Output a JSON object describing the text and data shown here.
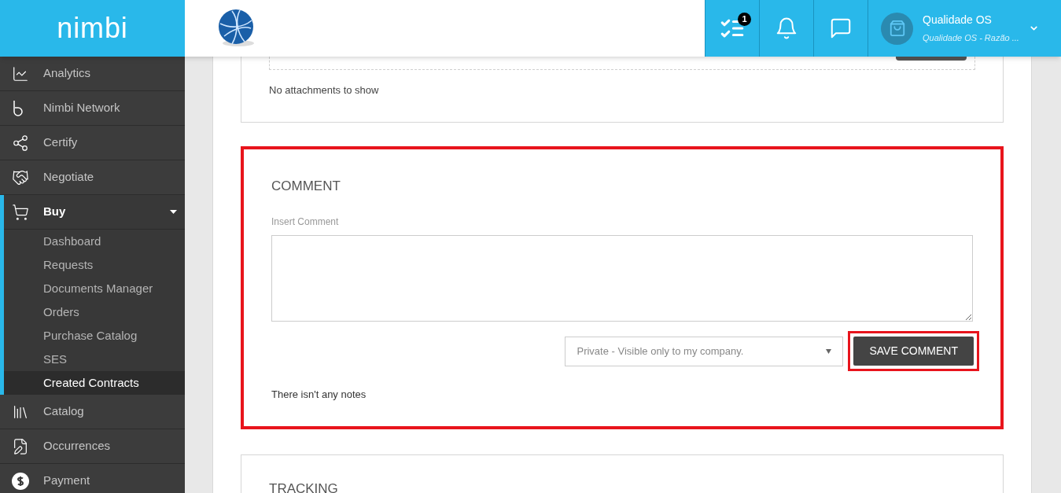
{
  "brand": {
    "logo": "nimbi"
  },
  "header": {
    "task_badge": "1",
    "user": {
      "name": "Qualidade OS",
      "company": "Qualidade OS - Razão ..."
    }
  },
  "sidebar": {
    "items": [
      {
        "label": "Analytics",
        "selected": false
      },
      {
        "label": "Nimbi Network",
        "selected": false
      },
      {
        "label": "Certify",
        "selected": false
      },
      {
        "label": "Negotiate",
        "selected": false
      },
      {
        "label": "Buy",
        "selected": true,
        "expanded": true,
        "children": [
          {
            "label": "Dashboard",
            "selected": false
          },
          {
            "label": "Requests",
            "selected": false
          },
          {
            "label": "Documents Manager",
            "selected": false
          },
          {
            "label": "Orders",
            "selected": false
          },
          {
            "label": "Purchase Catalog",
            "selected": false
          },
          {
            "label": "SES",
            "selected": false
          },
          {
            "label": "Created Contracts",
            "selected": true
          }
        ]
      },
      {
        "label": "Catalog",
        "selected": false
      },
      {
        "label": "Occurrences",
        "selected": false
      },
      {
        "label": "Payment",
        "selected": false
      }
    ]
  },
  "attachments": {
    "empty_text": "No attachments to show"
  },
  "comment": {
    "title": "COMMENT",
    "highlighted": true,
    "field_label": "Insert Comment",
    "visibility": "Private - Visible only to my company.",
    "save_button": "SAVE COMMENT",
    "save_highlighted": true,
    "empty_text": "There isn't any notes"
  },
  "tracking": {
    "title": "TRACKING"
  }
}
